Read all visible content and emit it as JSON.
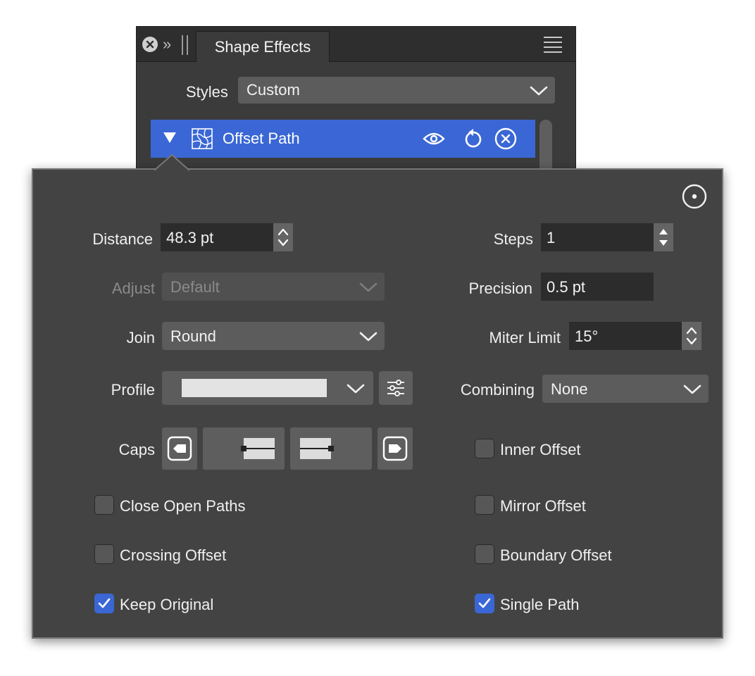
{
  "panel": {
    "tab_title": "Shape Effects",
    "styles_label": "Styles",
    "styles_value": "Custom",
    "effect": {
      "name": "Offset Path",
      "expanded": true,
      "icons": [
        "disclosure-triangle-icon",
        "offset-path-icon",
        "eye-icon",
        "reset-icon",
        "remove-icon"
      ]
    }
  },
  "popover": {
    "distance": {
      "label": "Distance",
      "value": "48.3 pt"
    },
    "steps": {
      "label": "Steps",
      "value": "1"
    },
    "adjust": {
      "label": "Adjust",
      "value": "Default",
      "disabled": true
    },
    "precision": {
      "label": "Precision",
      "value": "0.5 pt"
    },
    "join": {
      "label": "Join",
      "value": "Round"
    },
    "miter_limit": {
      "label": "Miter Limit",
      "value": "15°"
    },
    "profile": {
      "label": "Profile"
    },
    "combining": {
      "label": "Combining",
      "value": "None"
    },
    "caps": {
      "label": "Caps"
    },
    "checkboxes": {
      "inner_offset": {
        "label": "Inner Offset",
        "checked": false
      },
      "close_open_paths": {
        "label": "Close Open Paths",
        "checked": false
      },
      "mirror_offset": {
        "label": "Mirror Offset",
        "checked": false
      },
      "crossing_offset": {
        "label": "Crossing Offset",
        "checked": false
      },
      "boundary_offset": {
        "label": "Boundary Offset",
        "checked": false
      },
      "keep_original": {
        "label": "Keep Original",
        "checked": true
      },
      "single_path": {
        "label": "Single Path",
        "checked": true
      }
    }
  },
  "colors": {
    "accent": "#3a67d5",
    "panel_bg": "#3b3b3b",
    "popover_bg": "#434343",
    "field_bg": "#2c2c2c"
  }
}
